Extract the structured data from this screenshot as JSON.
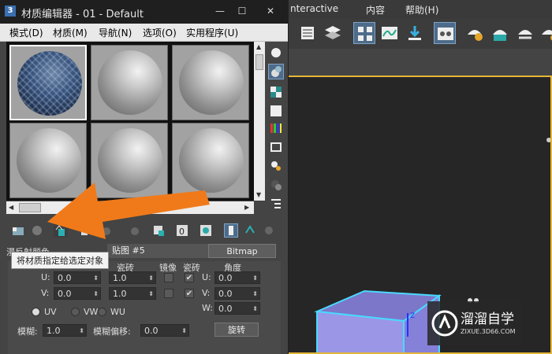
{
  "main_window": {
    "menu": [
      "nteractive",
      "内容",
      "帮助(H)"
    ]
  },
  "material_editor": {
    "title": "材质编辑器 - 01 - Default",
    "app_icon_label": "3",
    "menu": [
      "模式(D)",
      "材质(M)",
      "导航(N)",
      "选项(O)",
      "实用程序(U)"
    ],
    "slots": [
      {
        "kind": "textured",
        "selected": true
      },
      {
        "kind": "plain",
        "selected": false
      },
      {
        "kind": "plain",
        "selected": false
      },
      {
        "kind": "plain",
        "selected": false
      },
      {
        "kind": "plain",
        "selected": false
      },
      {
        "kind": "plain",
        "selected": false
      }
    ],
    "tooltip": "将材质指定给选定对象",
    "map_row": {
      "label": "漫反射颜色",
      "map_field": "贴图 #5",
      "bitmap_button": "Bitmap"
    },
    "params": {
      "col_header_tiling": "瓷砖",
      "col_header_mirror": "镜像",
      "col_header_tile": "瓷砖",
      "col_header_angle": "角度",
      "u_label": "U:",
      "v_label": "V:",
      "w_label": "W:",
      "u_offset": "0.0",
      "v_offset": "0.0",
      "u_tiling": "1.0",
      "v_tiling": "1.0",
      "u_angle": "0.0",
      "v_angle": "0.0",
      "w_angle": "0.0",
      "check_mark": "✔",
      "radio_uv": "UV",
      "radio_vw": "VW",
      "radio_wu": "WU",
      "blur_label": "模糊:",
      "blur_value": "1.0",
      "blur_offset_label": "模糊偏移:",
      "blur_offset_value": "0.0",
      "rotate_button": "旋转"
    }
  },
  "watermark": {
    "main": "溜溜自学",
    "sub": "ZIXUE.3D66.COM"
  },
  "colors": {
    "arrow": "#f07a1a",
    "viewport_border": "#e5b638",
    "object": "#9b96e6"
  }
}
